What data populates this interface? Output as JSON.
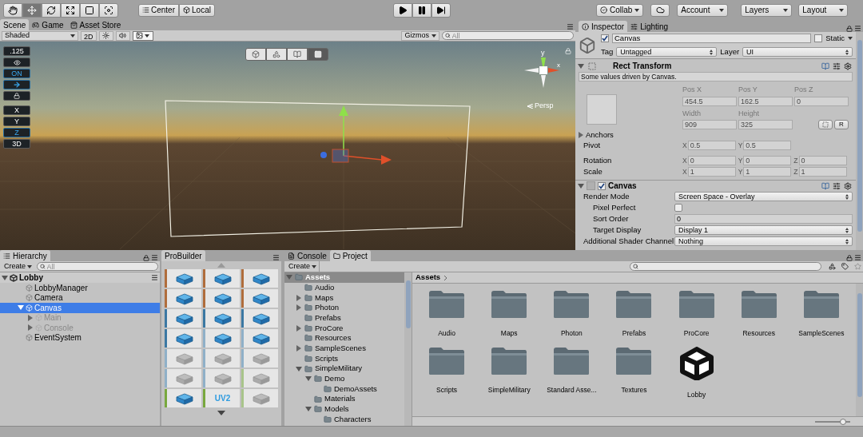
{
  "toolbar": {
    "tools": [
      {
        "selected": false
      },
      {
        "selected": true
      },
      {
        "selected": false
      },
      {
        "selected": false
      },
      {
        "selected": false
      },
      {
        "selected": false
      }
    ],
    "pivot_mode": "Center",
    "pivot_rotation": "Local",
    "collab": "Collab",
    "account": "Account",
    "layers": "Layers",
    "layout": "Layout"
  },
  "scene": {
    "tabs": [
      {
        "label": "Scene",
        "selected": true
      },
      {
        "label": "Game",
        "selected": false
      },
      {
        "label": "Asset Store",
        "selected": false
      }
    ],
    "draw_mode": "Shaded",
    "toggle_2d": "2D",
    "view_toggles": [
      {
        "kind": "lighting",
        "on": false
      },
      {
        "kind": "audio",
        "on": false
      },
      {
        "kind": "effects",
        "on": true
      }
    ],
    "gizmos": "Gizmos",
    "search": {
      "placeholder": "All"
    },
    "view_tools": [
      {
        "selected": false
      },
      {
        "selected": false
      },
      {
        "selected": false
      },
      {
        "selected": true
      }
    ],
    "overlay_buttons": [
      {
        "kind": "label",
        "label": ".125",
        "active": false
      },
      {
        "kind": "eye",
        "active": false
      },
      {
        "kind": "label",
        "label": "ON",
        "active": true
      },
      {
        "kind": "arrow",
        "active": true
      },
      {
        "kind": "lock",
        "active": false
      },
      {
        "kind": "label",
        "label": "X",
        "active": false
      },
      {
        "kind": "label",
        "label": "Y",
        "active": false
      },
      {
        "kind": "label",
        "label": "Z",
        "active": true
      },
      {
        "kind": "label",
        "label": "3D",
        "active": false
      }
    ],
    "axis_labels": [
      "y",
      "x"
    ],
    "projection": "Persp"
  },
  "inspector": {
    "tabs": [
      {
        "label": "Inspector",
        "selected": true
      },
      {
        "label": "Lighting",
        "selected": false
      }
    ],
    "object": {
      "active": true,
      "name": "Canvas",
      "static_label": "Static",
      "static": false,
      "tag_label": "Tag",
      "tag": "Untagged",
      "layer_label": "Layer",
      "layer": "UI"
    },
    "rect_transform": {
      "title": "Rect Transform",
      "expanded": true,
      "note": "Some values driven by Canvas.",
      "pos_labels": [
        "Pos X",
        "Pos Y",
        "Pos Z"
      ],
      "pos_values": [
        "454.5",
        "162.5",
        "0"
      ],
      "size_labels": [
        "Width",
        "Height"
      ],
      "size_values": [
        "909",
        "325"
      ],
      "raw_button": "R",
      "anchors": {
        "label": "Anchors",
        "expanded": false
      },
      "rows": [
        {
          "label": "Pivot",
          "fields": [
            {
              "axis": "X",
              "value": "0.5"
            },
            {
              "axis": "Y",
              "value": "0.5"
            }
          ]
        },
        {
          "label": "Rotation",
          "fields": [
            {
              "axis": "X",
              "value": "0"
            },
            {
              "axis": "Y",
              "value": "0"
            },
            {
              "axis": "Z",
              "value": "0"
            }
          ]
        },
        {
          "label": "Scale",
          "fields": [
            {
              "axis": "X",
              "value": "1"
            },
            {
              "axis": "Y",
              "value": "1"
            },
            {
              "axis": "Z",
              "value": "1"
            }
          ]
        }
      ]
    },
    "canvas": {
      "title": "Canvas",
      "enabled": true,
      "expanded": true,
      "props": [
        {
          "kind": "dropdown",
          "label": "Render Mode",
          "value": "Screen Space - Overlay",
          "children": [
            {
              "kind": "checkbox",
              "label": "Pixel Perfect",
              "checked": false
            },
            {
              "kind": "field",
              "label": "Sort Order",
              "value": "0"
            },
            {
              "kind": "dropdown",
              "label": "Target Display",
              "value": "Display 1"
            }
          ]
        },
        {
          "kind": "dropdown",
          "label": "Additional Shader Channel",
          "value": "Nothing"
        }
      ]
    }
  },
  "hierarchy": {
    "tab": "Hierarchy",
    "create": "Create",
    "search": {
      "placeholder": "All"
    },
    "scene": {
      "label": "Lobby",
      "expanded": true,
      "children": [
        {
          "label": "LobbyManager",
          "selected": false,
          "inactive": false
        },
        {
          "label": "Camera",
          "selected": false,
          "inactive": false
        },
        {
          "label": "Canvas",
          "selected": true,
          "inactive": false,
          "expanded": true,
          "children": [
            {
              "label": "Main",
              "selected": false,
              "inactive": true,
              "expanded": false
            },
            {
              "label": "Console",
              "selected": false,
              "inactive": true,
              "expanded": false
            }
          ]
        },
        {
          "label": "EventSystem",
          "selected": false,
          "inactive": false
        }
      ]
    }
  },
  "probuilder": {
    "tab": "ProBuilder",
    "tiles": [
      {
        "color": "#b06d3c",
        "disabled": false
      },
      {
        "color": "#b06d3c",
        "disabled": false
      },
      {
        "color": "#b06d3c",
        "disabled": false
      },
      {
        "color": "#b06d3c",
        "disabled": false
      },
      {
        "color": "#b06d3c",
        "disabled": false
      },
      {
        "color": "#b06d3c",
        "disabled": false
      },
      {
        "color": "#3b78a3",
        "disabled": false
      },
      {
        "color": "#3b78a3",
        "disabled": false
      },
      {
        "color": "#3b78a3",
        "disabled": false
      },
      {
        "color": "#3b78a3",
        "disabled": false
      },
      {
        "color": "#8fb0c8",
        "disabled": false
      },
      {
        "color": "#8fb0c8",
        "disabled": false
      },
      {
        "color": "#8fb0c8",
        "disabled": true
      },
      {
        "color": "#8fb0c8",
        "disabled": true
      },
      {
        "color": "#8fb0c8",
        "disabled": true
      },
      {
        "color": "#8fb0c8",
        "disabled": true
      },
      {
        "color": "#8fb0c8",
        "disabled": true
      },
      {
        "color": "#a8c48a",
        "disabled": true
      },
      {
        "color": "#78a83e",
        "disabled": false
      },
      {
        "color": "#78a83e",
        "disabled": false,
        "label": "UV2"
      },
      {
        "color": "#a8c48a",
        "disabled": true
      }
    ]
  },
  "project": {
    "tabs": [
      {
        "label": "Console",
        "selected": false
      },
      {
        "label": "Project",
        "selected": true
      }
    ],
    "create": "Create",
    "tree": [
      {
        "label": "Assets",
        "selected": true,
        "expanded": true,
        "children": [
          {
            "label": "Audio",
            "selected": false
          },
          {
            "label": "Maps",
            "selected": false,
            "expanded": false
          },
          {
            "label": "Photon",
            "selected": false,
            "expanded": false
          },
          {
            "label": "Prefabs",
            "selected": false
          },
          {
            "label": "ProCore",
            "selected": false,
            "expanded": false
          },
          {
            "label": "Resources",
            "selected": false
          },
          {
            "label": "SampleScenes",
            "selected": false,
            "expanded": false
          },
          {
            "label": "Scripts",
            "selected": false
          },
          {
            "label": "SimpleMilitary",
            "selected": false,
            "expanded": true,
            "children": [
              {
                "label": "Demo",
                "selected": false,
                "expanded": true,
                "children": [
                  {
                    "label": "DemoAssets",
                    "selected": false
                  }
                ]
              },
              {
                "label": "Materials",
                "selected": false
              },
              {
                "label": "Models",
                "selected": false,
                "expanded": true,
                "children": [
                  {
                    "label": "Characters",
                    "selected": false
                  }
                ]
              }
            ]
          }
        ]
      }
    ],
    "breadcrumb": "Assets",
    "items": [
      {
        "kind": "folder",
        "label": "Audio"
      },
      {
        "kind": "folder",
        "label": "Maps"
      },
      {
        "kind": "folder",
        "label": "Photon"
      },
      {
        "kind": "folder",
        "label": "Prefabs"
      },
      {
        "kind": "folder",
        "label": "ProCore"
      },
      {
        "kind": "folder",
        "label": "Resources"
      },
      {
        "kind": "folder",
        "label": "SampleScenes"
      },
      {
        "kind": "folder",
        "label": "Scripts"
      },
      {
        "kind": "folder",
        "label": "SimpleMilitary"
      },
      {
        "kind": "folder",
        "label": "Standard Asse..."
      },
      {
        "kind": "folder",
        "label": "Textures"
      },
      {
        "kind": "scene",
        "label": "Lobby"
      }
    ],
    "icon_size": {
      "level": 0.8
    }
  }
}
